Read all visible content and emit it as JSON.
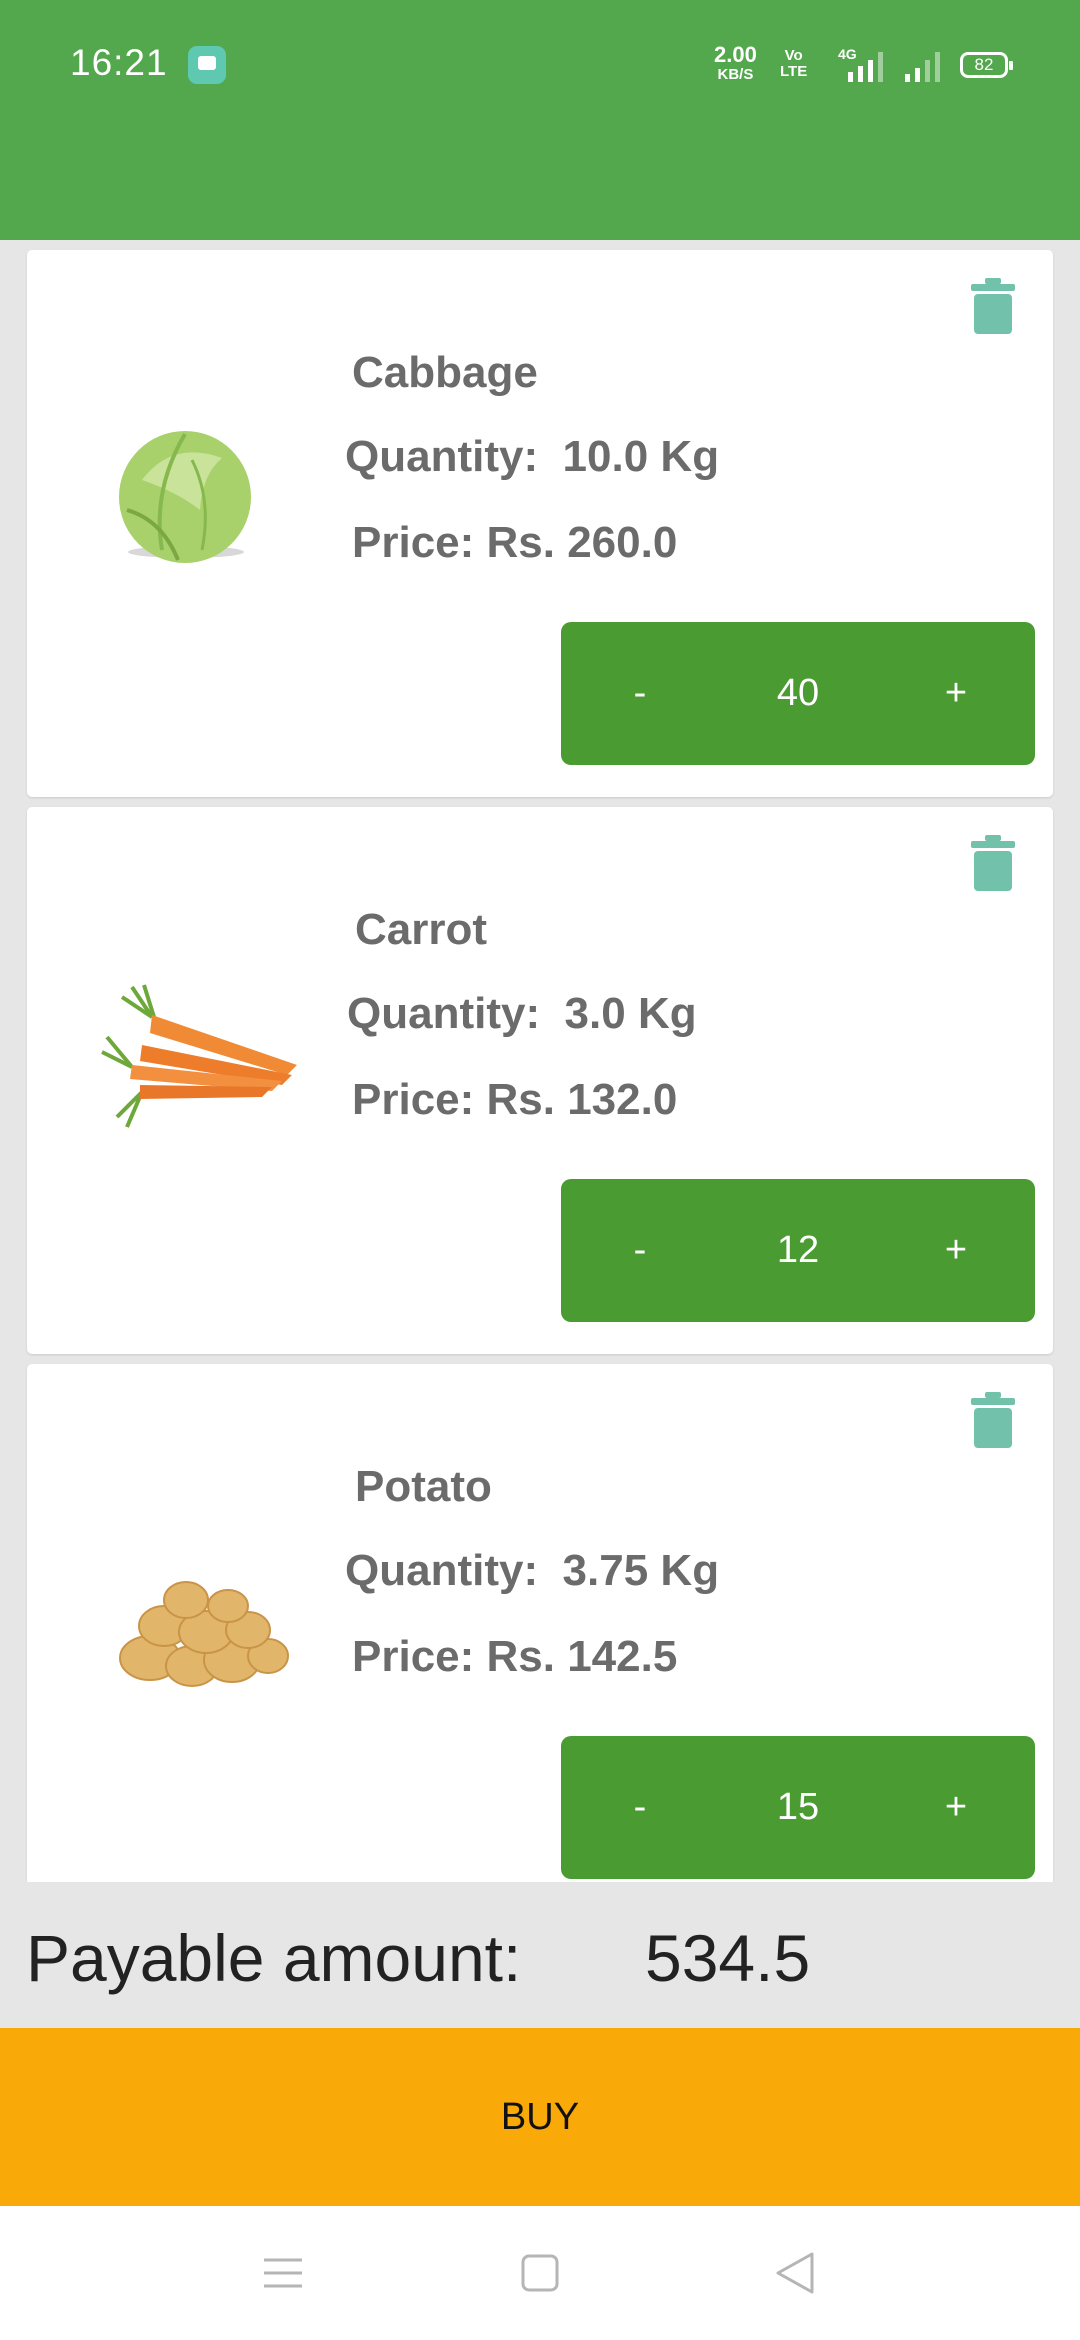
{
  "status_bar": {
    "time": "16:21",
    "net_speed_value": "2.00",
    "net_speed_unit": "KB/S",
    "volte_top": "Vo",
    "volte_bottom": "LTE",
    "signal_label": "4G",
    "battery": "82"
  },
  "icons": {
    "message": "message-icon",
    "delete": "trash-icon",
    "menu": "menu-icon",
    "home": "square-home-icon",
    "back": "triangle-back-icon"
  },
  "cart": {
    "items": [
      {
        "name": "Cabbage",
        "quantity": "Quantity:  10.0 Kg",
        "price": "Price: Rs. 260.0",
        "minus": "-",
        "count": "40",
        "plus": "+"
      },
      {
        "name": "Carrot",
        "quantity": "Quantity:  3.0 Kg",
        "price": "Price: Rs. 132.0",
        "minus": "-",
        "count": "12",
        "plus": "+"
      },
      {
        "name": "Potato",
        "quantity": "Quantity:  3.75 Kg",
        "price": "Price: Rs. 142.5",
        "minus": "-",
        "count": "15",
        "plus": "+"
      }
    ]
  },
  "payable": {
    "label": "Payable amount:",
    "value": "534.5"
  },
  "buy_label": "BUY",
  "colors": {
    "primary_green": "#53a74c",
    "stepper_green": "#4a9c32",
    "buy_orange": "#f9a908",
    "delete_teal": "#72c2ab"
  }
}
